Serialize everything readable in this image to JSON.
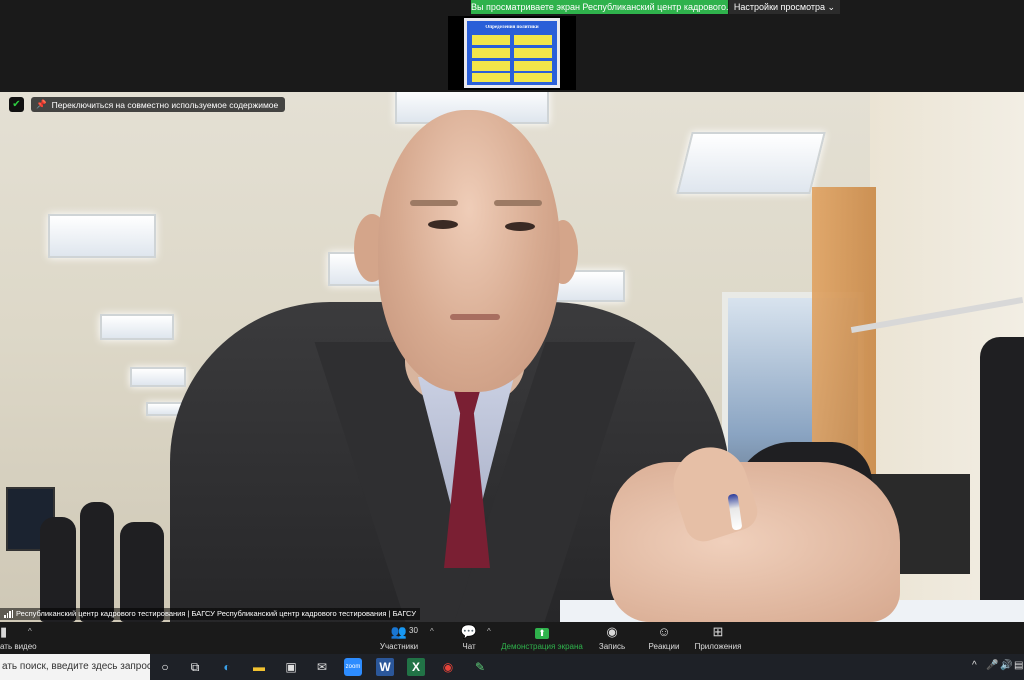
{
  "banner": {
    "share_text": "Вы просматриваете экран Республиканский центр кадрового...",
    "view_options": "Настройки просмотра ⌄"
  },
  "shared_content": {
    "slide_title": "Определения политики"
  },
  "video": {
    "pin_label": "Переключиться на совместно используемое содержимое",
    "participant_name": "Республиканский центр кадрового тестирования | БАГСУ Республиканский центр кадрового тестирования | БАГСУ"
  },
  "toolbar": {
    "video_label": "ать видео",
    "participants_label": "Участники",
    "participants_count": "30",
    "chat_label": "Чат",
    "share_label": "Демонстрация экрана",
    "record_label": "Запись",
    "reactions_label": "Реакции",
    "apps_label": "Приложения"
  },
  "taskbar": {
    "search_placeholder": "ать поиск, введите здесь запрос"
  },
  "colors": {
    "share_green": "#2fb24c",
    "toolbar_bg": "#1a1a1a",
    "taskbar_bg": "#1e2127"
  }
}
